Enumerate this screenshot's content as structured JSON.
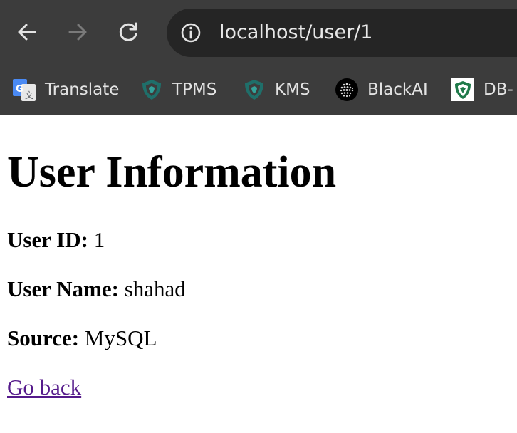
{
  "browser": {
    "url": "localhost/user/1",
    "bookmarks": [
      {
        "label": "Translate",
        "icon": "google-translate-icon"
      },
      {
        "label": "TPMS",
        "icon": "shield-icon"
      },
      {
        "label": "KMS",
        "icon": "shield-icon"
      },
      {
        "label": "BlackAI",
        "icon": "dots-sphere-icon"
      },
      {
        "label": "DB-",
        "icon": "emblem-icon"
      }
    ],
    "colors": {
      "frame": "#3c3c3c",
      "omnibox": "#252525",
      "text": "#e8e8e8"
    }
  },
  "page": {
    "title": "User Information",
    "fields": [
      {
        "label": "User ID:",
        "value": " 1"
      },
      {
        "label": "User Name:",
        "value": " shahad"
      },
      {
        "label": "Source:",
        "value": " MySQL"
      }
    ],
    "back_link": "Go back",
    "colors": {
      "link": "#551a8b"
    }
  }
}
